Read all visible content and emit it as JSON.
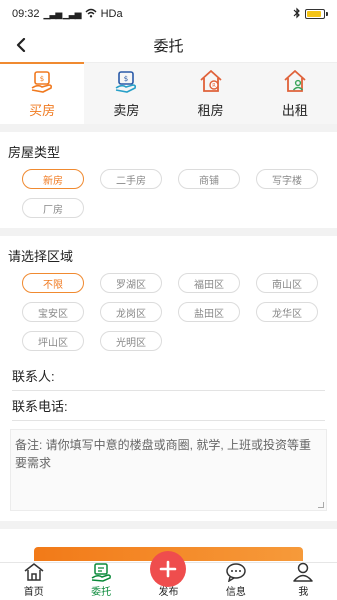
{
  "status_bar": {
    "time": "09:32",
    "signal": "▁▃▅ ▁▃▅",
    "network": "HDa",
    "battery_level": 0.85
  },
  "header": {
    "title": "委托"
  },
  "tabs": [
    {
      "label": "买房",
      "icon": "buy-house-icon",
      "active": true
    },
    {
      "label": "卖房",
      "icon": "sell-house-icon",
      "active": false
    },
    {
      "label": "租房",
      "icon": "rent-house-icon",
      "active": false
    },
    {
      "label": "出租",
      "icon": "lease-out-icon",
      "active": false
    }
  ],
  "house_type": {
    "title": "房屋类型",
    "options": [
      "新房",
      "二手房",
      "商铺",
      "写字楼",
      "厂房"
    ],
    "selected": "新房"
  },
  "region": {
    "title": "请选择区域",
    "options": [
      "不限",
      "罗湖区",
      "福田区",
      "南山区",
      "宝安区",
      "龙岗区",
      "盐田区",
      "龙华区",
      "坪山区",
      "光明区"
    ],
    "selected": "不限"
  },
  "form": {
    "contact_label": "联系人:",
    "phone_label": "联系电话:",
    "notes_placeholder": "备注: 请你填写中意的楼盘或商圈, 就学, 上班或投资等重要需求"
  },
  "bottom_nav": [
    {
      "label": "首页",
      "icon": "home-icon",
      "active": false
    },
    {
      "label": "委托",
      "icon": "entrust-icon",
      "active": true
    },
    {
      "label": "发布",
      "icon": "plus-icon",
      "active": false
    },
    {
      "label": "信息",
      "icon": "message-icon",
      "active": false
    },
    {
      "label": "我",
      "icon": "user-icon",
      "active": false
    }
  ],
  "colors": {
    "accent": "#f07a20",
    "nav_active": "#0a8a3a",
    "publish": "#ef4d4d"
  }
}
